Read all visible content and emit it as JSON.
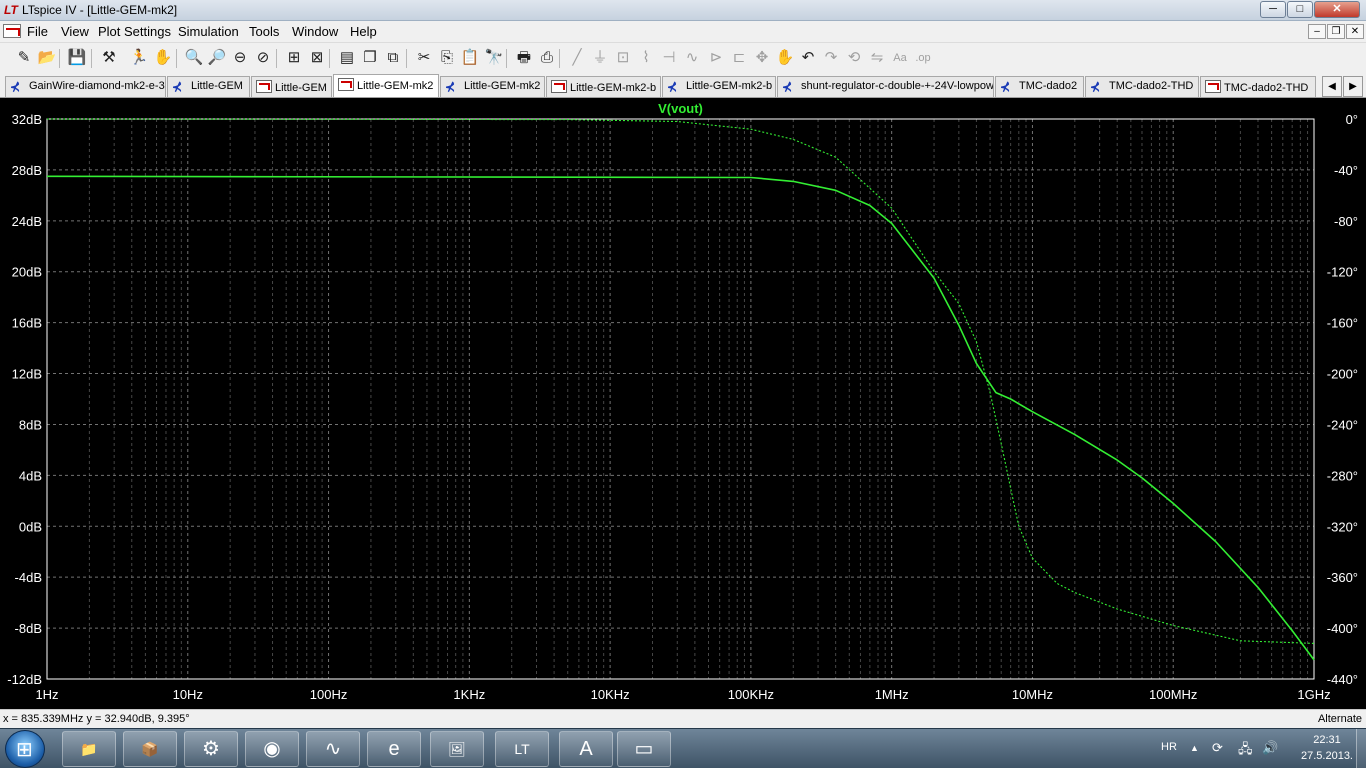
{
  "window": {
    "title": "LTspice IV - [Little-GEM-mk2]",
    "app_icon_text": "LT",
    "minimize": "─",
    "maximize": "□",
    "close": "✕"
  },
  "menu": {
    "items": [
      "File",
      "View",
      "Plot Settings",
      "Simulation",
      "Tools",
      "Window",
      "Help"
    ],
    "mdi_minimize": "–",
    "mdi_restore": "❐",
    "mdi_close": "✕"
  },
  "toolbar": {
    "icons": [
      {
        "name": "new-schematic-icon",
        "glyph": "✎",
        "enabled": true
      },
      {
        "name": "open-icon",
        "glyph": "📂",
        "enabled": true
      },
      {
        "name": "save-icon",
        "glyph": "💾",
        "enabled": true
      },
      {
        "name": "control-panel-icon",
        "glyph": "⚒",
        "enabled": true
      },
      {
        "name": "run-icon",
        "glyph": "🏃",
        "enabled": true
      },
      {
        "name": "pan-icon",
        "glyph": "✋",
        "enabled": true
      },
      {
        "name": "zoom-in-icon",
        "glyph": "🔍",
        "enabled": true
      },
      {
        "name": "zoom-area-icon",
        "glyph": "🔎",
        "enabled": true
      },
      {
        "name": "zoom-out-icon",
        "glyph": "⊖",
        "enabled": true
      },
      {
        "name": "zoom-cancel-icon",
        "glyph": "⊘",
        "enabled": true
      },
      {
        "name": "autorange-icon",
        "glyph": "⊞",
        "enabled": true
      },
      {
        "name": "fft-icon",
        "glyph": "⊠",
        "enabled": true
      },
      {
        "name": "tile-horizontal-icon",
        "glyph": "▤",
        "enabled": true
      },
      {
        "name": "cascade-icon",
        "glyph": "❐",
        "enabled": true
      },
      {
        "name": "close-all-icon",
        "glyph": "⧉",
        "enabled": true
      },
      {
        "name": "cut-icon",
        "glyph": "✂",
        "enabled": true
      },
      {
        "name": "copy-icon",
        "glyph": "⎘",
        "enabled": true
      },
      {
        "name": "paste-icon",
        "glyph": "📋",
        "enabled": true
      },
      {
        "name": "find-icon",
        "glyph": "🔭",
        "enabled": true
      },
      {
        "name": "print-setup-icon",
        "glyph": "🖶",
        "enabled": true
      },
      {
        "name": "print-icon",
        "glyph": "⎙",
        "enabled": true
      },
      {
        "name": "wire-icon",
        "glyph": "╱",
        "enabled": false
      },
      {
        "name": "ground-icon",
        "glyph": "⏚",
        "enabled": false
      },
      {
        "name": "label-icon",
        "glyph": "⊡",
        "enabled": false
      },
      {
        "name": "resistor-icon",
        "glyph": "⌇",
        "enabled": false
      },
      {
        "name": "capacitor-icon",
        "glyph": "⊣",
        "enabled": false
      },
      {
        "name": "inductor-icon",
        "glyph": "∿",
        "enabled": false
      },
      {
        "name": "diode-icon",
        "glyph": "⊳",
        "enabled": false
      },
      {
        "name": "component-icon",
        "glyph": "⊏",
        "enabled": false
      },
      {
        "name": "move-icon",
        "glyph": "✥",
        "enabled": false
      },
      {
        "name": "drag-icon",
        "glyph": "✋",
        "enabled": false
      },
      {
        "name": "undo-icon",
        "glyph": "↶",
        "enabled": true
      },
      {
        "name": "redo-icon",
        "glyph": "↷",
        "enabled": false
      },
      {
        "name": "rotate-icon",
        "glyph": "⟲",
        "enabled": false
      },
      {
        "name": "mirror-icon",
        "glyph": "⇋",
        "enabled": false
      },
      {
        "name": "text-icon",
        "glyph": "Aa",
        "enabled": false
      },
      {
        "name": "spice-directive-icon",
        "glyph": ".op",
        "enabled": false
      }
    ]
  },
  "tabs": [
    {
      "label": "GainWire-diamond-mk2-e-3",
      "kind": "schematic",
      "active": false
    },
    {
      "label": "Little-GEM",
      "kind": "schematic",
      "active": false
    },
    {
      "label": "Little-GEM",
      "kind": "waveform",
      "active": false
    },
    {
      "label": "Little-GEM-mk2",
      "kind": "waveform",
      "active": true
    },
    {
      "label": "Little-GEM-mk2",
      "kind": "schematic",
      "active": false
    },
    {
      "label": "Little-GEM-mk2-b",
      "kind": "waveform",
      "active": false
    },
    {
      "label": "Little-GEM-mk2-b",
      "kind": "schematic",
      "active": false
    },
    {
      "label": "shunt-regulator-c-double-+-24V-lowpow",
      "kind": "schematic",
      "active": false
    },
    {
      "label": "TMC-dado2",
      "kind": "schematic",
      "active": false
    },
    {
      "label": "TMC-dado2-THD",
      "kind": "schematic",
      "active": false
    },
    {
      "label": "TMC-dado2-THD",
      "kind": "waveform",
      "active": false
    }
  ],
  "tab_scroll": {
    "left": "◀",
    "right": "▶"
  },
  "chart_data": {
    "type": "line",
    "title": "V(vout)",
    "x_scale": "log",
    "xlim": [
      1,
      1000000000
    ],
    "x_ticks": [
      {
        "label": "1Hz",
        "value": 1
      },
      {
        "label": "10Hz",
        "value": 10
      },
      {
        "label": "100Hz",
        "value": 100
      },
      {
        "label": "1KHz",
        "value": 1000
      },
      {
        "label": "10KHz",
        "value": 10000
      },
      {
        "label": "100KHz",
        "value": 100000
      },
      {
        "label": "1MHz",
        "value": 1000000
      },
      {
        "label": "10MHz",
        "value": 10000000
      },
      {
        "label": "100MHz",
        "value": 100000000
      },
      {
        "label": "1GHz",
        "value": 1000000000
      }
    ],
    "ylim": [
      -12,
      32
    ],
    "y_ticks": [
      {
        "label": "32dB",
        "value": 32
      },
      {
        "label": "28dB",
        "value": 28
      },
      {
        "label": "24dB",
        "value": 24
      },
      {
        "label": "20dB",
        "value": 20
      },
      {
        "label": "16dB",
        "value": 16
      },
      {
        "label": "12dB",
        "value": 12
      },
      {
        "label": "8dB",
        "value": 8
      },
      {
        "label": "4dB",
        "value": 4
      },
      {
        "label": "0dB",
        "value": 0
      },
      {
        "label": "-4dB",
        "value": -4
      },
      {
        "label": "-8dB",
        "value": -8
      },
      {
        "label": "-12dB",
        "value": -12
      }
    ],
    "y2lim": [
      -440,
      0
    ],
    "y2_ticks": [
      {
        "label": "0°",
        "value": 0
      },
      {
        "label": "-40°",
        "value": -40
      },
      {
        "label": "-80°",
        "value": -80
      },
      {
        "label": "-120°",
        "value": -120
      },
      {
        "label": "-160°",
        "value": -160
      },
      {
        "label": "-200°",
        "value": -200
      },
      {
        "label": "-240°",
        "value": -240
      },
      {
        "label": "-280°",
        "value": -280
      },
      {
        "label": "-320°",
        "value": -320
      },
      {
        "label": "-360°",
        "value": -360
      },
      {
        "label": "-400°",
        "value": -400
      },
      {
        "label": "-440°",
        "value": -440
      }
    ],
    "grid": true,
    "background": "#000000",
    "grid_color": "#808080",
    "axis_text_color": "#ffffff",
    "series": [
      {
        "name": "V(vout)",
        "role": "magnitude",
        "axis": "left",
        "color": "#33ee33",
        "style": "solid",
        "x": [
          1,
          100000,
          200000,
          400000,
          700000,
          1000000,
          2000000,
          3000000,
          4000000,
          5500000,
          7000000,
          10000000,
          20000000,
          40000000,
          60000000,
          100000000,
          200000000,
          400000000,
          700000000,
          1000000000
        ],
        "y": [
          27.5,
          27.4,
          27.1,
          26.4,
          25.2,
          23.8,
          19.5,
          15.8,
          12.8,
          10.5,
          10.0,
          9.0,
          7.2,
          5.2,
          3.8,
          1.8,
          -1.2,
          -4.8,
          -8.2,
          -10.5
        ]
      },
      {
        "name": "V(vout)",
        "role": "phase",
        "axis": "right",
        "color": "#33ee33",
        "style": "dotted",
        "x": [
          1,
          5000,
          30000,
          100000,
          200000,
          400000,
          1000000,
          2000000,
          3000000,
          4000000,
          5000000,
          6000000,
          7000000,
          8000000,
          10000000,
          15000000,
          20000000,
          40000000,
          100000000,
          300000000,
          1000000000
        ],
        "y": [
          0,
          -0.5,
          -2,
          -8,
          -16,
          -30,
          -70,
          -120,
          -145,
          -175,
          -215,
          -255,
          -290,
          -320,
          -345,
          -365,
          -372,
          -385,
          -398,
          -410,
          -412
        ]
      }
    ]
  },
  "status": {
    "cursor_readout": "x = 835.339MHz    y = 32.940dB, 9.395°",
    "mode": "Alternate"
  },
  "taskbar": {
    "apps": [
      {
        "name": "explorer-app-icon",
        "glyph": "📁"
      },
      {
        "name": "installer-app-icon",
        "glyph": "📦"
      },
      {
        "name": "utility-app-icon",
        "glyph": "⚙"
      },
      {
        "name": "security-app-icon",
        "glyph": "◉"
      },
      {
        "name": "oscilloscope-app-icon",
        "glyph": "∿"
      },
      {
        "name": "ie-app-icon",
        "glyph": "e"
      },
      {
        "name": "gallery-app-icon",
        "glyph": "🖼"
      },
      {
        "name": "ltspice-app-icon",
        "glyph": "LT"
      },
      {
        "name": "wordpad-app-icon",
        "glyph": "A"
      },
      {
        "name": "notes-app-icon",
        "glyph": "▭"
      }
    ],
    "language": "HR",
    "tray_icons": [
      {
        "name": "show-hidden-icon",
        "glyph": "▲"
      },
      {
        "name": "sync-icon",
        "glyph": "⟳"
      },
      {
        "name": "network-icon",
        "glyph": "🖧"
      },
      {
        "name": "volume-icon",
        "glyph": "🔊"
      }
    ],
    "time": "22:31",
    "date": "27.5.2013."
  }
}
